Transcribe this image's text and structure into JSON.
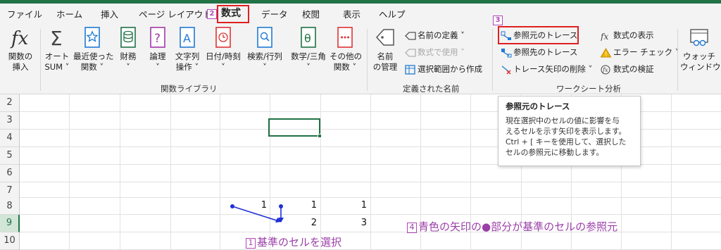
{
  "tabs": [
    "ファイル",
    "ホーム",
    "挿入",
    "ページ レイアウト",
    "数式",
    "データ",
    "校閲",
    "表示",
    "ヘルプ"
  ],
  "active_tab": "数式",
  "ribbon": {
    "insert_function": [
      "関数の",
      "挿入"
    ],
    "autosum": [
      "オート",
      "SUM ˅"
    ],
    "recent": [
      "最近使った",
      "関数 ˅"
    ],
    "financial": [
      "財務",
      "˅"
    ],
    "logical": [
      "論理",
      "˅"
    ],
    "text": [
      "文字列",
      "操作 ˅"
    ],
    "datetime": [
      "日付/時刻",
      "˅"
    ],
    "lookup": [
      "検索/行列",
      "˅"
    ],
    "math": [
      "数学/三角",
      "˅"
    ],
    "more": [
      "その他の",
      "関数 ˅"
    ],
    "group_library": "関数ライブラリ",
    "name_manager": [
      "名前",
      "の管理"
    ],
    "define_name": "名前の定義 ˅",
    "use_in_formula": "数式で使用 ˅",
    "create_from_selection": "選択範囲から作成",
    "group_names": "定義された名前",
    "trace_precedents": "参照元のトレース",
    "trace_dependents": "参照先のトレース",
    "remove_arrows": "トレース矢印の削除 ˅",
    "show_formulas": "数式の表示",
    "error_checking": "エラー チェック ˅",
    "evaluate_formula": "数式の検証",
    "watch_window": [
      "ウォッチ",
      "ウィンドウ"
    ],
    "group_audit": "ワークシート分析"
  },
  "badges": {
    "b2": "2",
    "b3": "3"
  },
  "rows": [
    "2",
    "3",
    "4",
    "5",
    "6",
    "7",
    "8",
    "9",
    "10"
  ],
  "cells": {
    "r8c1": "1",
    "r8c2": "1",
    "r8c3": "1",
    "r9c2": "2",
    "r9c3": "3"
  },
  "tooltip": {
    "title": "参照元のトレース",
    "body": [
      "現在選択中のセルの値に影響を与",
      "えるセルを示す矢印を表示します。",
      "Ctrl + [ キーを使用して、選択した",
      "セルの参照元に移動します。"
    ]
  },
  "annotations": {
    "a1_num": "1",
    "a1": "基準のセルを選択",
    "a4_num": "4",
    "a4": "青色の矢印の●部分が基準のセルの参照元"
  },
  "colors": {
    "accent": "#217346",
    "arrow": "#1e2fd6",
    "annotation": "#9b3fa8",
    "highlight": "#e02020"
  }
}
